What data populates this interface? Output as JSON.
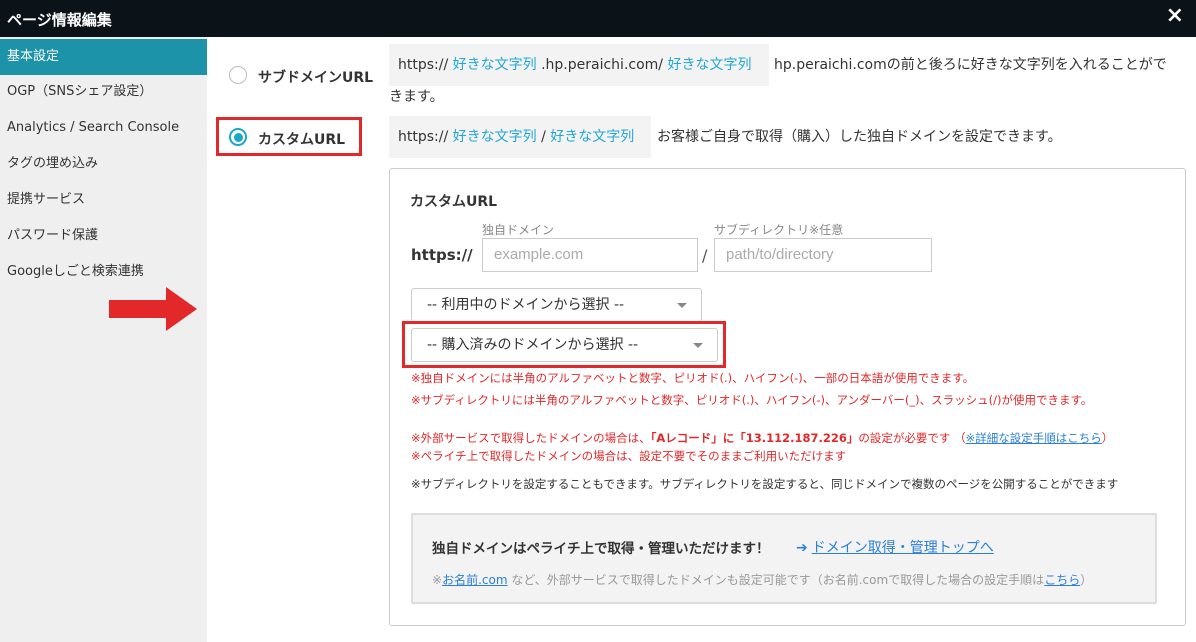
{
  "window": {
    "title": "ページ情報編集",
    "close": "×"
  },
  "sidebar": {
    "items": [
      {
        "label": "基本設定",
        "active": true
      },
      {
        "label": "OGP（SNSシェア設定）"
      },
      {
        "label": "Analytics / Search Console"
      },
      {
        "label": "タグの埋め込み"
      },
      {
        "label": "提携サービス"
      },
      {
        "label": "パスワード保護"
      },
      {
        "label": "Googleしごと検索連携"
      }
    ]
  },
  "subdomain": {
    "label": "サブドメインURL",
    "url_prefix": "https://",
    "url_part1": "好きな文字列",
    "url_mid": ".hp.peraichi.com/",
    "url_part2": "好きな文字列",
    "desc_line1": "hp.peraichi.comの前と後ろに好きな文字列を入れることがで",
    "desc_line2": "きます。"
  },
  "custom": {
    "label": "カスタムURL",
    "url_prefix": "https://",
    "url_part1": "好きな文字列",
    "url_sep": "/",
    "url_part2": "好きな文字列",
    "desc": "お客様ご自身で取得（購入）した独自ドメインを設定できます。"
  },
  "panel": {
    "title": "カスタムURL",
    "domain_label": "独自ドメイン",
    "subdir_label": "サブディレクトリ※任意",
    "https": "https://",
    "domain_placeholder": "example.com",
    "slash": "/",
    "subdir_placeholder": "path/to/directory",
    "select_in_use": "-- 利用中のドメインから選択 --",
    "select_purchased": "-- 購入済みのドメインから選択 --",
    "note1": "※独自ドメインには半角のアルファベットと数字、ピリオド(.)、ハイフン(-)、一部の日本語が使用できます。",
    "note2": "※サブディレクトリには半角のアルファベットと数字、ピリオド(.)、ハイフン(-)、アンダーバー(_)、スラッシュ(/)が使用できます。",
    "note3_pre": "※外部サービスで取得したドメインの場合は、",
    "note3_bold": "「Aレコード」に「13.112.187.226」",
    "note3_post": "の設定が必要です （",
    "note3_link": "※詳細な設定手順はこちら",
    "note3_end": "）",
    "note4": "※ペライチ上で取得したドメインの場合は、設定不要でそのままご利用いただけます",
    "note5": "※サブディレクトリを設定することもできます。サブディレクトリを設定すると、同じドメインで複数のページを公開することができます",
    "info_head": "独自ドメインはペライチ上で取得・管理いただけます！",
    "info_link": "ドメイン取得・管理トップへ",
    "info_sub_pre": "※",
    "info_sub_link1": "お名前.com",
    "info_sub_mid": " など、外部サービスで取得したドメインも設定可能です（お名前.comで取得した場合の設定手順は",
    "info_sub_link2": "こちら",
    "info_sub_end": "）"
  },
  "colors": {
    "accent": "#1d93a9",
    "highlight": "#e3282a",
    "link": "#2b7fd6"
  }
}
